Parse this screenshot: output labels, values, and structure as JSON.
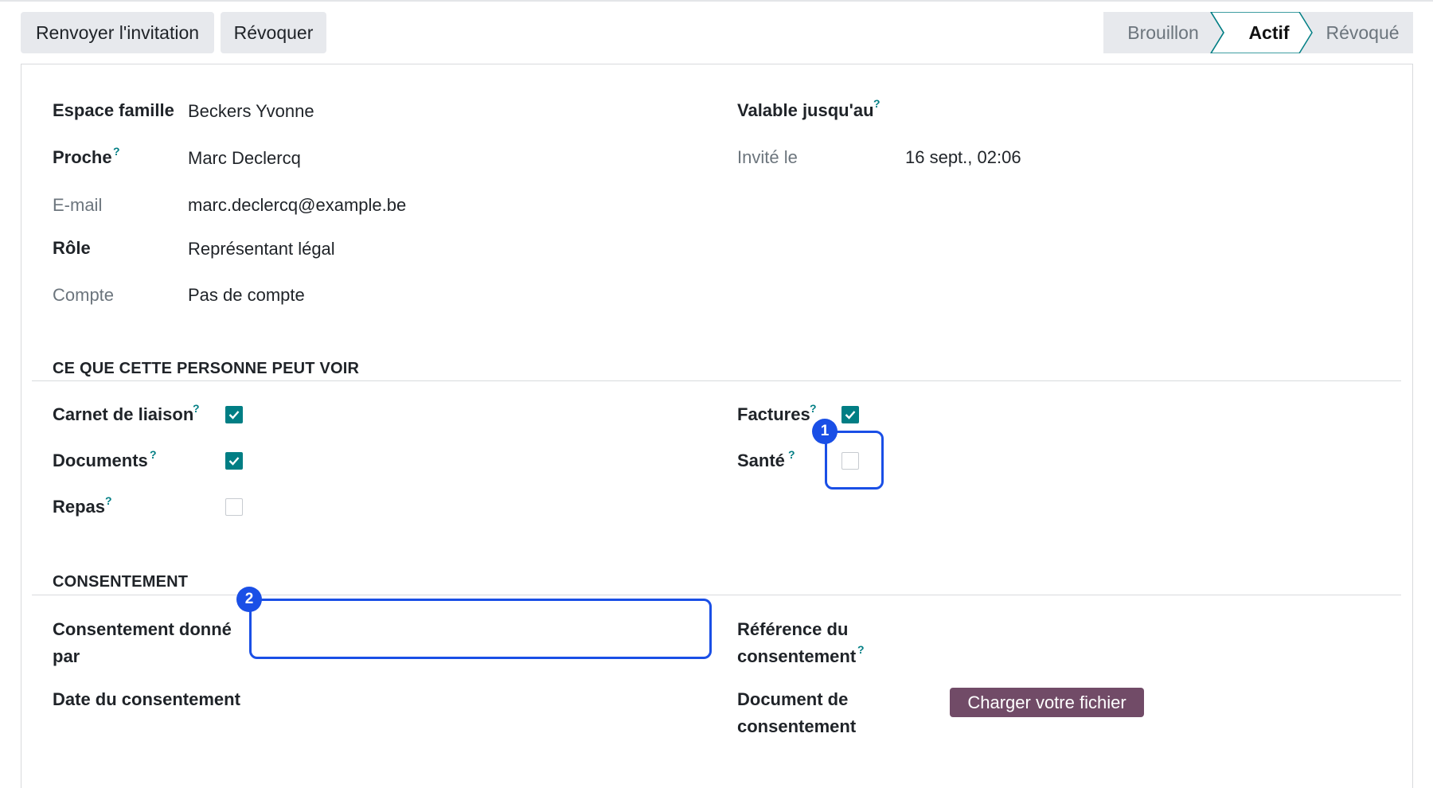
{
  "actions": {
    "resend_label": "Renvoyer l'invitation",
    "revoke_label": "Révoquer"
  },
  "statusbar": {
    "stages": [
      "Brouillon",
      "Actif",
      "Révoqué"
    ],
    "current": "Actif"
  },
  "fields": {
    "family_space": {
      "label": "Espace famille",
      "value": "Beckers Yvonne"
    },
    "relative": {
      "label": "Proche",
      "help": "?",
      "value": "Marc Declercq"
    },
    "email": {
      "label": "E-mail",
      "value": "marc.declercq@example.be"
    },
    "role": {
      "label": "Rôle",
      "value": "Représentant légal"
    },
    "account": {
      "label": "Compte",
      "value": "Pas de compte"
    },
    "valid_until": {
      "label": "Valable jusqu'au",
      "help": "?",
      "value": ""
    },
    "invited_on": {
      "label": "Invité le",
      "value": "16 sept., 02:06"
    }
  },
  "visibility": {
    "title": "CE QUE CETTE PERSONNE PEUT VOIR",
    "items": [
      {
        "label": "Carnet de liaison",
        "help": "?",
        "checked": true
      },
      {
        "label": "Documents",
        "help": "?",
        "checked": true
      },
      {
        "label": "Repas",
        "help": "?",
        "checked": false
      },
      {
        "label": "Factures",
        "help": "?",
        "checked": true
      },
      {
        "label": "Santé",
        "help": "?",
        "checked": false
      }
    ]
  },
  "consent": {
    "title": "CONSENTEMENT",
    "given_by_label_1": "Consentement donné",
    "given_by_label_2": "par",
    "given_by_value": "",
    "reference_label_1": "Référence du",
    "reference_label_2": "consentement",
    "reference_help": "?",
    "date_label": "Date du consentement",
    "document_label_1": "Document de",
    "document_label_2": "consentement",
    "upload_label": "Charger votre fichier"
  },
  "markers": [
    "1",
    "2"
  ],
  "colors": {
    "accent": "#017e84",
    "highlight": "#1a4fe6",
    "upload_button": "#714b67"
  }
}
